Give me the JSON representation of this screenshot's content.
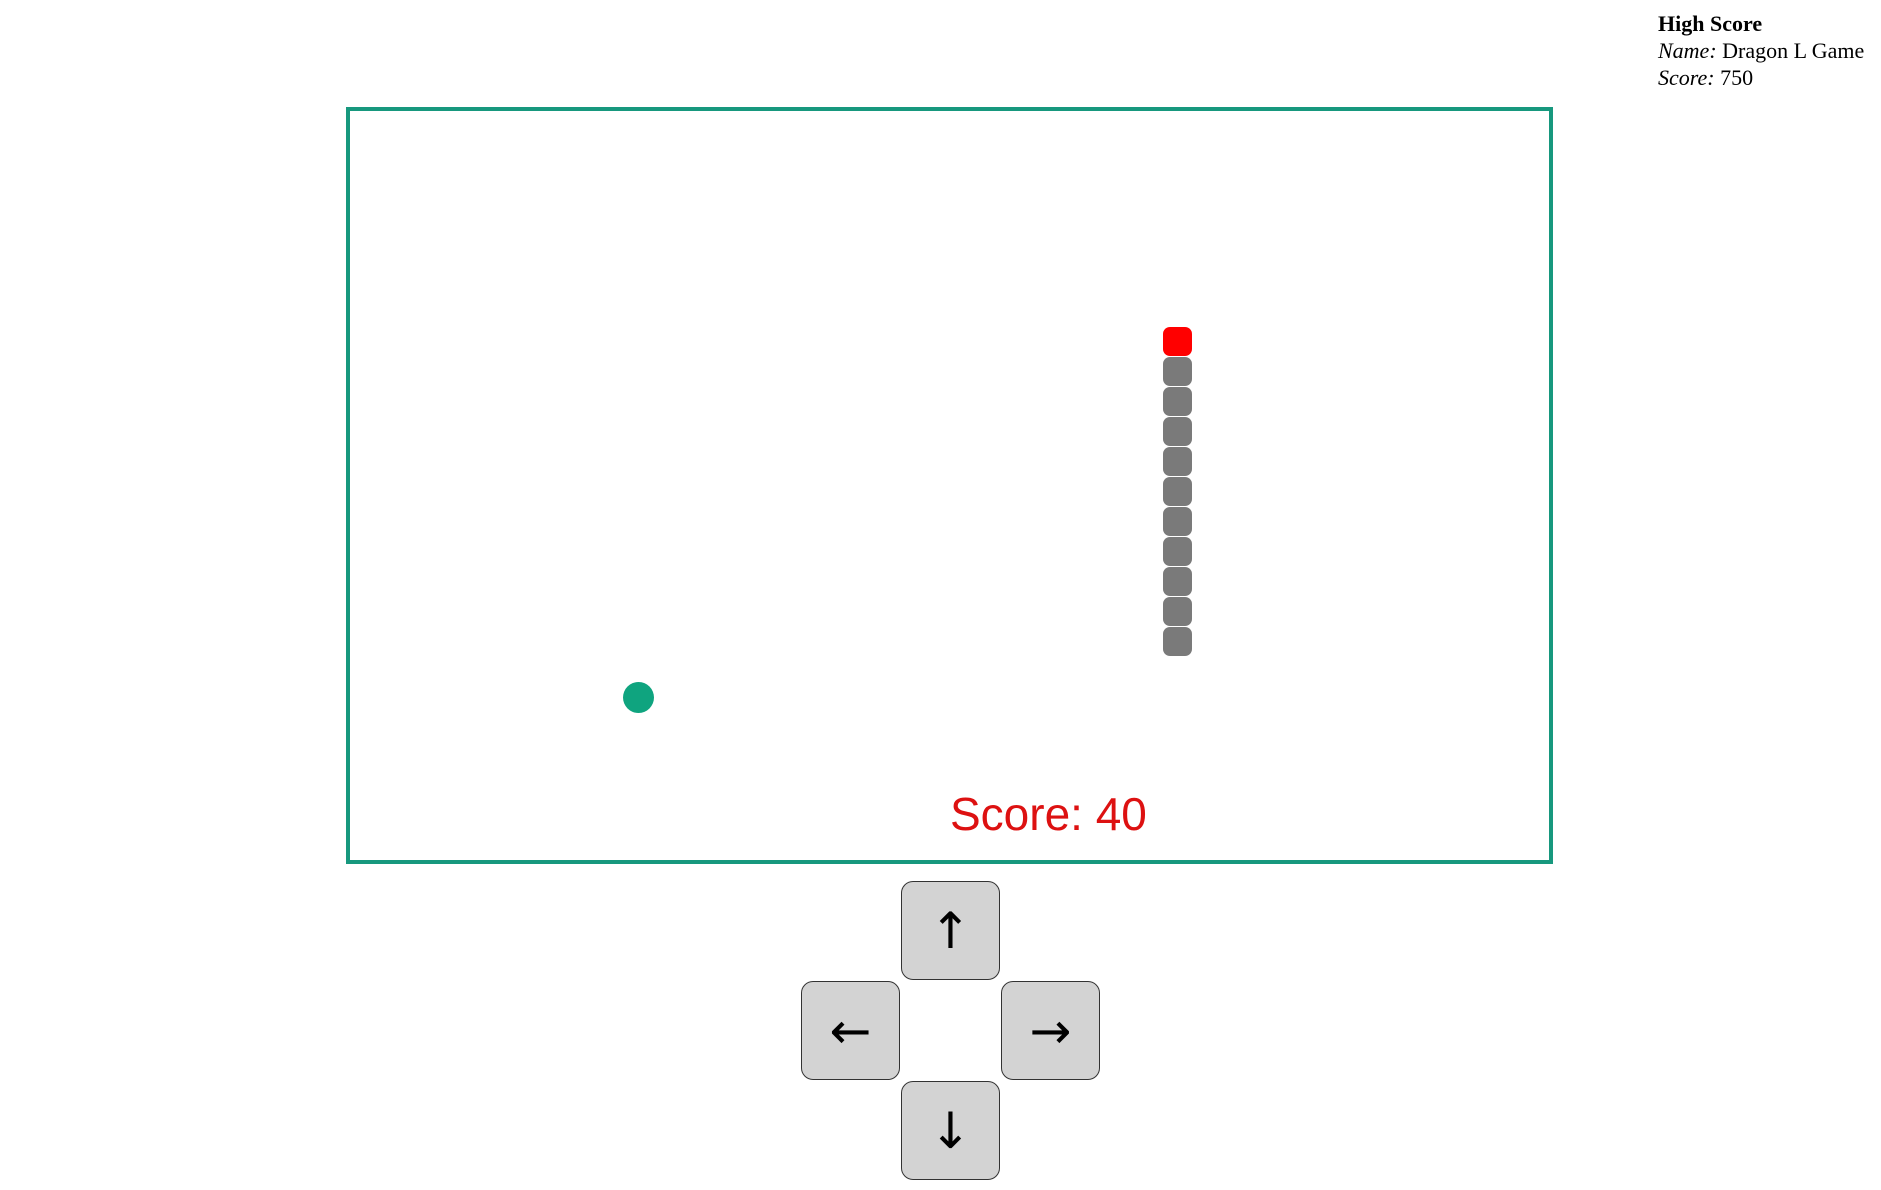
{
  "high_score": {
    "title": "High Score",
    "name_label": "Name:",
    "name_value": "Dragon L Game",
    "score_label": "Score:",
    "score_value": "750"
  },
  "game": {
    "score_text": "Score: 40",
    "snake_segments": 11,
    "colors": {
      "border": "#17987e",
      "snake_head": "#ff0000",
      "snake_body": "#7a7a7a",
      "food": "#0fa47f",
      "score": "#dd1111"
    }
  },
  "controls": {
    "up": "↑",
    "left": "←",
    "right": "→",
    "down": "↓"
  }
}
